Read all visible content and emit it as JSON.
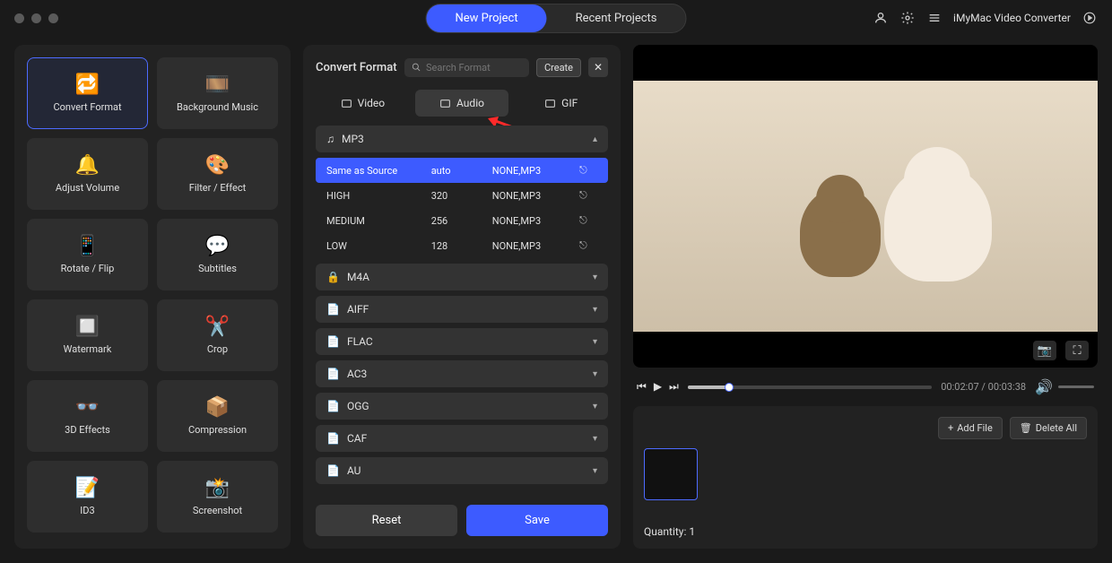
{
  "app_title": "iMyMac Video Converter",
  "top_tabs": {
    "new_project": "New Project",
    "recent_projects": "Recent Projects"
  },
  "tools": [
    {
      "label": "Convert Format",
      "icon": "🔁"
    },
    {
      "label": "Background Music",
      "icon": "🎞️"
    },
    {
      "label": "Adjust Volume",
      "icon": "🔔"
    },
    {
      "label": "Filter / Effect",
      "icon": "🎨"
    },
    {
      "label": "Rotate / Flip",
      "icon": "📱"
    },
    {
      "label": "Subtitles",
      "icon": "💬"
    },
    {
      "label": "Watermark",
      "icon": "🔲"
    },
    {
      "label": "Crop",
      "icon": "✂️"
    },
    {
      "label": "3D Effects",
      "icon": "👓"
    },
    {
      "label": "Compression",
      "icon": "📦"
    },
    {
      "label": "ID3",
      "icon": "📝"
    },
    {
      "label": "Screenshot",
      "icon": "📸"
    }
  ],
  "center": {
    "title": "Convert Format",
    "search_placeholder": "Search Format",
    "create": "Create",
    "tabs": {
      "video": "Video",
      "audio": "Audio",
      "gif": "GIF"
    },
    "expanded_format": "MP3",
    "presets": [
      {
        "name": "Same as Source",
        "bitrate": "auto",
        "codec": "NONE,MP3"
      },
      {
        "name": "HIGH",
        "bitrate": "320",
        "codec": "NONE,MP3"
      },
      {
        "name": "MEDIUM",
        "bitrate": "256",
        "codec": "NONE,MP3"
      },
      {
        "name": "LOW",
        "bitrate": "128",
        "codec": "NONE,MP3"
      }
    ],
    "formats": [
      "M4A",
      "AIFF",
      "FLAC",
      "AC3",
      "OGG",
      "CAF",
      "AU"
    ],
    "reset": "Reset",
    "save": "Save"
  },
  "player": {
    "current": "00:02:07",
    "total": "00:03:38"
  },
  "files": {
    "add": "Add File",
    "delete": "Delete All",
    "quantity_label": "Quantity:",
    "quantity": "1"
  }
}
